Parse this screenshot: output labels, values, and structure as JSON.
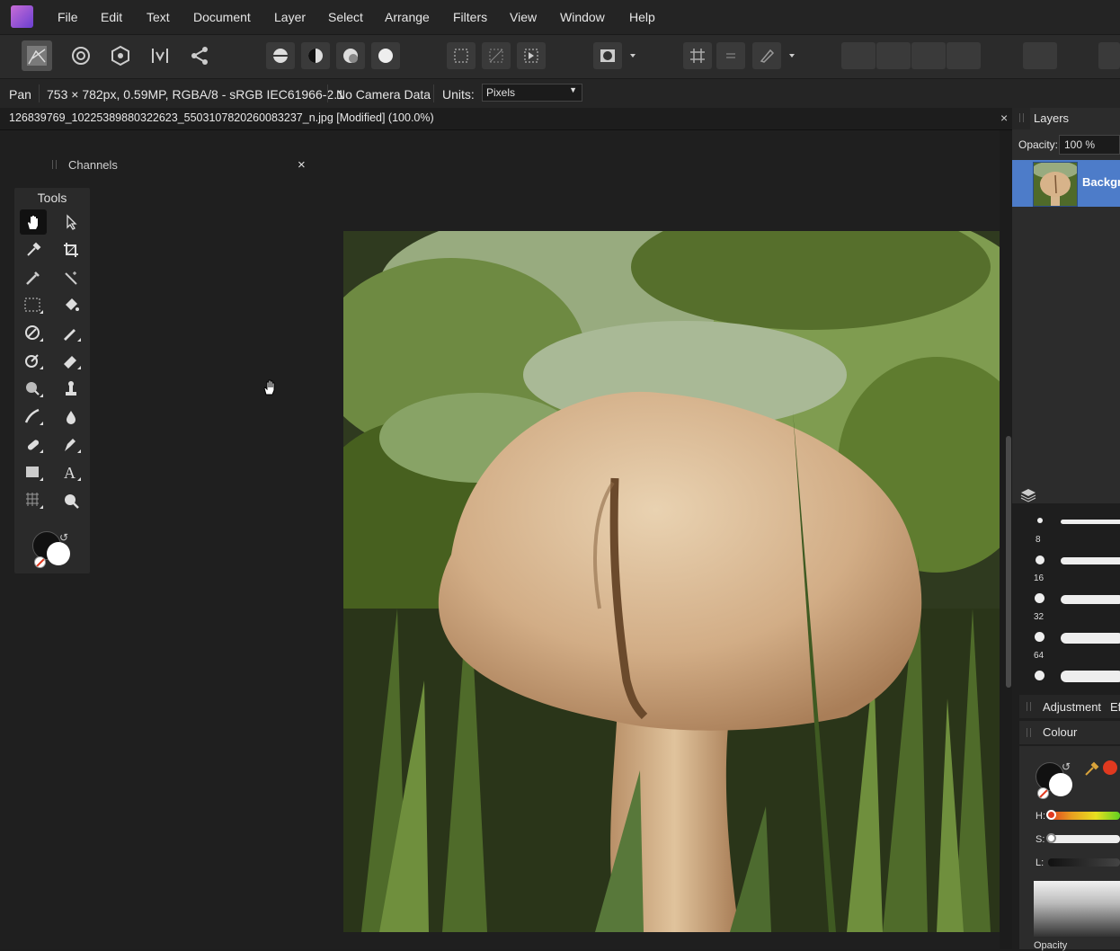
{
  "menu": {
    "items": [
      "File",
      "Edit",
      "Text",
      "Document",
      "Layer",
      "Select",
      "Arrange",
      "Filters",
      "View",
      "Window",
      "Help"
    ]
  },
  "context": {
    "tool_name": "Pan",
    "image_info": "753 × 782px, 0.59MP, RGBA/8 - sRGB IEC61966-2.1",
    "camera": "No Camera Data",
    "units_label": "Units:",
    "units_value": "Pixels"
  },
  "document": {
    "title": "126839769_10225389880322623_5503107820260083237_n.jpg [Modified] (100.0%)",
    "close_glyph": "×"
  },
  "channels": {
    "title": "Channels",
    "close_glyph": "×"
  },
  "tools": {
    "title": "Tools",
    "active": "hand-tool"
  },
  "layers": {
    "tab_label": "Layers",
    "opacity_label": "Opacity:",
    "opacity_value": "100 %",
    "layer_name": "Backgr"
  },
  "brushes": {
    "sizes": [
      "8",
      "16",
      "32",
      "64"
    ]
  },
  "panels": {
    "adjustment_label": "Adjustment",
    "effects_label": "Ef",
    "colour_label": "Colour"
  },
  "colour": {
    "h_label": "H:",
    "s_label": "S:",
    "l_label": "L:",
    "opacity_label": "Opacity",
    "accent": "#e0391f"
  }
}
